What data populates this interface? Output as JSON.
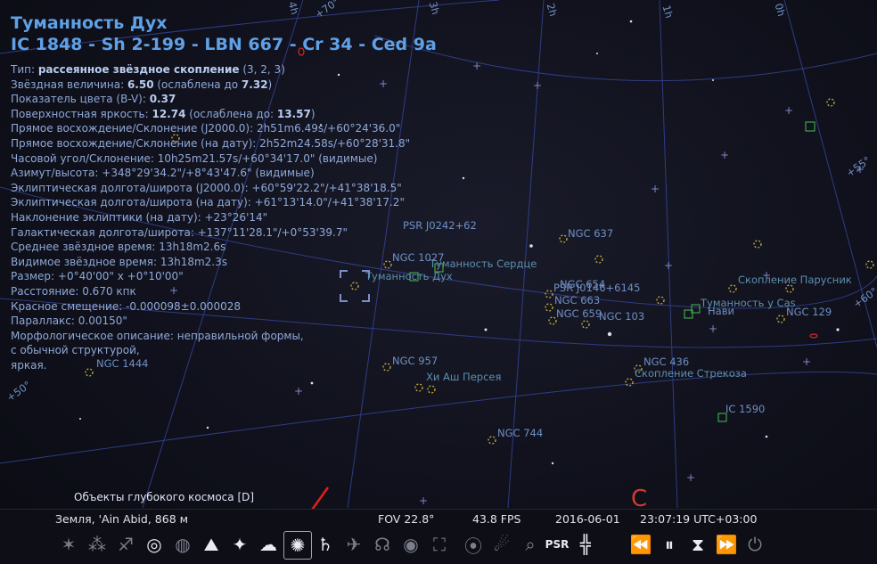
{
  "object": {
    "name_ru": "Туманность Дух",
    "designations": "IC 1848 - Sh 2-199 - LBN 667 - Cr 34 - Ced 9a",
    "lines": [
      {
        "key": "Тип: ",
        "val": "рассеянное звёздное скопление",
        "rest": " (3, 2, 3)"
      },
      {
        "key": "Звёздная величина: ",
        "val": "6.50",
        "rest": " (ослаблена до ",
        "val2": "7.32",
        "rest2": ")"
      },
      {
        "key": "Показатель цвета (B-V): ",
        "val": "0.37",
        "rest": ""
      },
      {
        "key": "Поверхностная яркость: ",
        "val": "12.74",
        "rest": " (ослаблена до: ",
        "val2": "13.57",
        "rest2": ")"
      },
      {
        "key": "Прямое восхождение/Склонение (J2000.0): ",
        "val": "",
        "rest": "2h51m6.49s/+60°24'36.0\""
      },
      {
        "key": "Прямое восхождение/Склонение (на дату): ",
        "val": "",
        "rest": "2h52m24.58s/+60°28'31.8\""
      },
      {
        "key": "Часовой угол/Склонение: ",
        "val": "",
        "rest": "10h25m21.57s/+60°34'17.0\" (видимые)"
      },
      {
        "key": "Азимут/высота: ",
        "val": "",
        "rest": "+348°29'34.2\"/+8°43'47.6\" (видимые)"
      },
      {
        "key": "Эклиптическая долгота/широта (J2000.0): ",
        "val": "",
        "rest": "+60°59'22.2\"/+41°38'18.5\""
      },
      {
        "key": "Эклиптическая долгота/широта (на дату): ",
        "val": "",
        "rest": "+61°13'14.0\"/+41°38'17.2\""
      },
      {
        "key": "Наклонение эклиптики (на дату): ",
        "val": "",
        "rest": "+23°26'14\""
      },
      {
        "key": "Галактическая долгота/широта: ",
        "val": "",
        "rest": "+137°11'28.1\"/+0°53'39.7\""
      },
      {
        "key": "Среднее звёздное время: ",
        "val": "",
        "rest": "13h18m2.6s"
      },
      {
        "key": "Видимое звёздное время: ",
        "val": "",
        "rest": "13h18m2.3s"
      },
      {
        "key": "Размер: ",
        "val": "",
        "rest": "+0°40'00\" x +0°10'00\""
      },
      {
        "key": "Расстояние: ",
        "val": "",
        "rest": "0.670 кпк"
      },
      {
        "key": "Красное смещение: ",
        "val": "",
        "rest": "-0.000098±0.000028"
      },
      {
        "key": "Параллакс: ",
        "val": "",
        "rest": "0.00150\""
      },
      {
        "key": "Морфологическое описание: ",
        "val": "",
        "rest": "неправильной формы,"
      },
      {
        "key": "",
        "val": "",
        "rest": "с обычной структурой,"
      },
      {
        "key": "",
        "val": "",
        "rest": "яркая."
      }
    ]
  },
  "sky_labels": [
    {
      "text": "PSR J0242+62",
      "cls": "lbl"
    },
    {
      "text": "NGC 637",
      "cls": "lbl"
    },
    {
      "text": "NGC 1027",
      "cls": "lbl"
    },
    {
      "text": "Туманность Сердце",
      "cls": "lbl cl"
    },
    {
      "text": "Туманность Дух",
      "cls": "lbl cl"
    },
    {
      "text": "NGC 654",
      "cls": "lbl"
    },
    {
      "text": "PSR J0146+6145",
      "cls": "lbl"
    },
    {
      "text": "NGC 663",
      "cls": "lbl"
    },
    {
      "text": "NGC 659",
      "cls": "lbl"
    },
    {
      "text": "NGC 103",
      "cls": "lbl"
    },
    {
      "text": "Скопление Парусник",
      "cls": "lbl cl"
    },
    {
      "text": "Туманность у Cas",
      "cls": "lbl cl"
    },
    {
      "text": "Нави",
      "cls": "lbl"
    },
    {
      "text": "NGC 129",
      "cls": "lbl"
    },
    {
      "text": "NGC 1444",
      "cls": "lbl"
    },
    {
      "text": "NGC 957",
      "cls": "lbl"
    },
    {
      "text": "Хи Аш Персея",
      "cls": "lbl cl"
    },
    {
      "text": "NGC 436",
      "cls": "lbl"
    },
    {
      "text": "Скопление Стрекоза",
      "cls": "lbl cl"
    },
    {
      "text": "IC 1590",
      "cls": "lbl"
    },
    {
      "text": "NGC 744",
      "cls": "lbl"
    },
    {
      "text": "+70°",
      "cls": "lbl"
    },
    {
      "text": "+55°",
      "cls": "lbl"
    },
    {
      "text": "+60°",
      "cls": "lbl"
    },
    {
      "text": "+50°",
      "cls": "lbl"
    },
    {
      "text": "4h",
      "cls": "lbl"
    },
    {
      "text": "3h",
      "cls": "lbl"
    },
    {
      "text": "2h",
      "cls": "lbl"
    },
    {
      "text": "1h",
      "cls": "lbl"
    },
    {
      "text": "0h",
      "cls": "lbl"
    }
  ],
  "toolbar": {
    "category_label": "Объекты глубокого космоса  [D]",
    "location": "Земля, 'Ain Abid, 868 м",
    "fov": "FOV 22.8°",
    "fps": "43.8 FPS",
    "date": "2016-06-01",
    "time": "23:07:19 UTC+03:00",
    "psr_label": "PSR"
  },
  "colors": {
    "accent": "#5fa0e6",
    "highlight_arrow": "#e0201c",
    "grid": "#3b4aa0"
  }
}
